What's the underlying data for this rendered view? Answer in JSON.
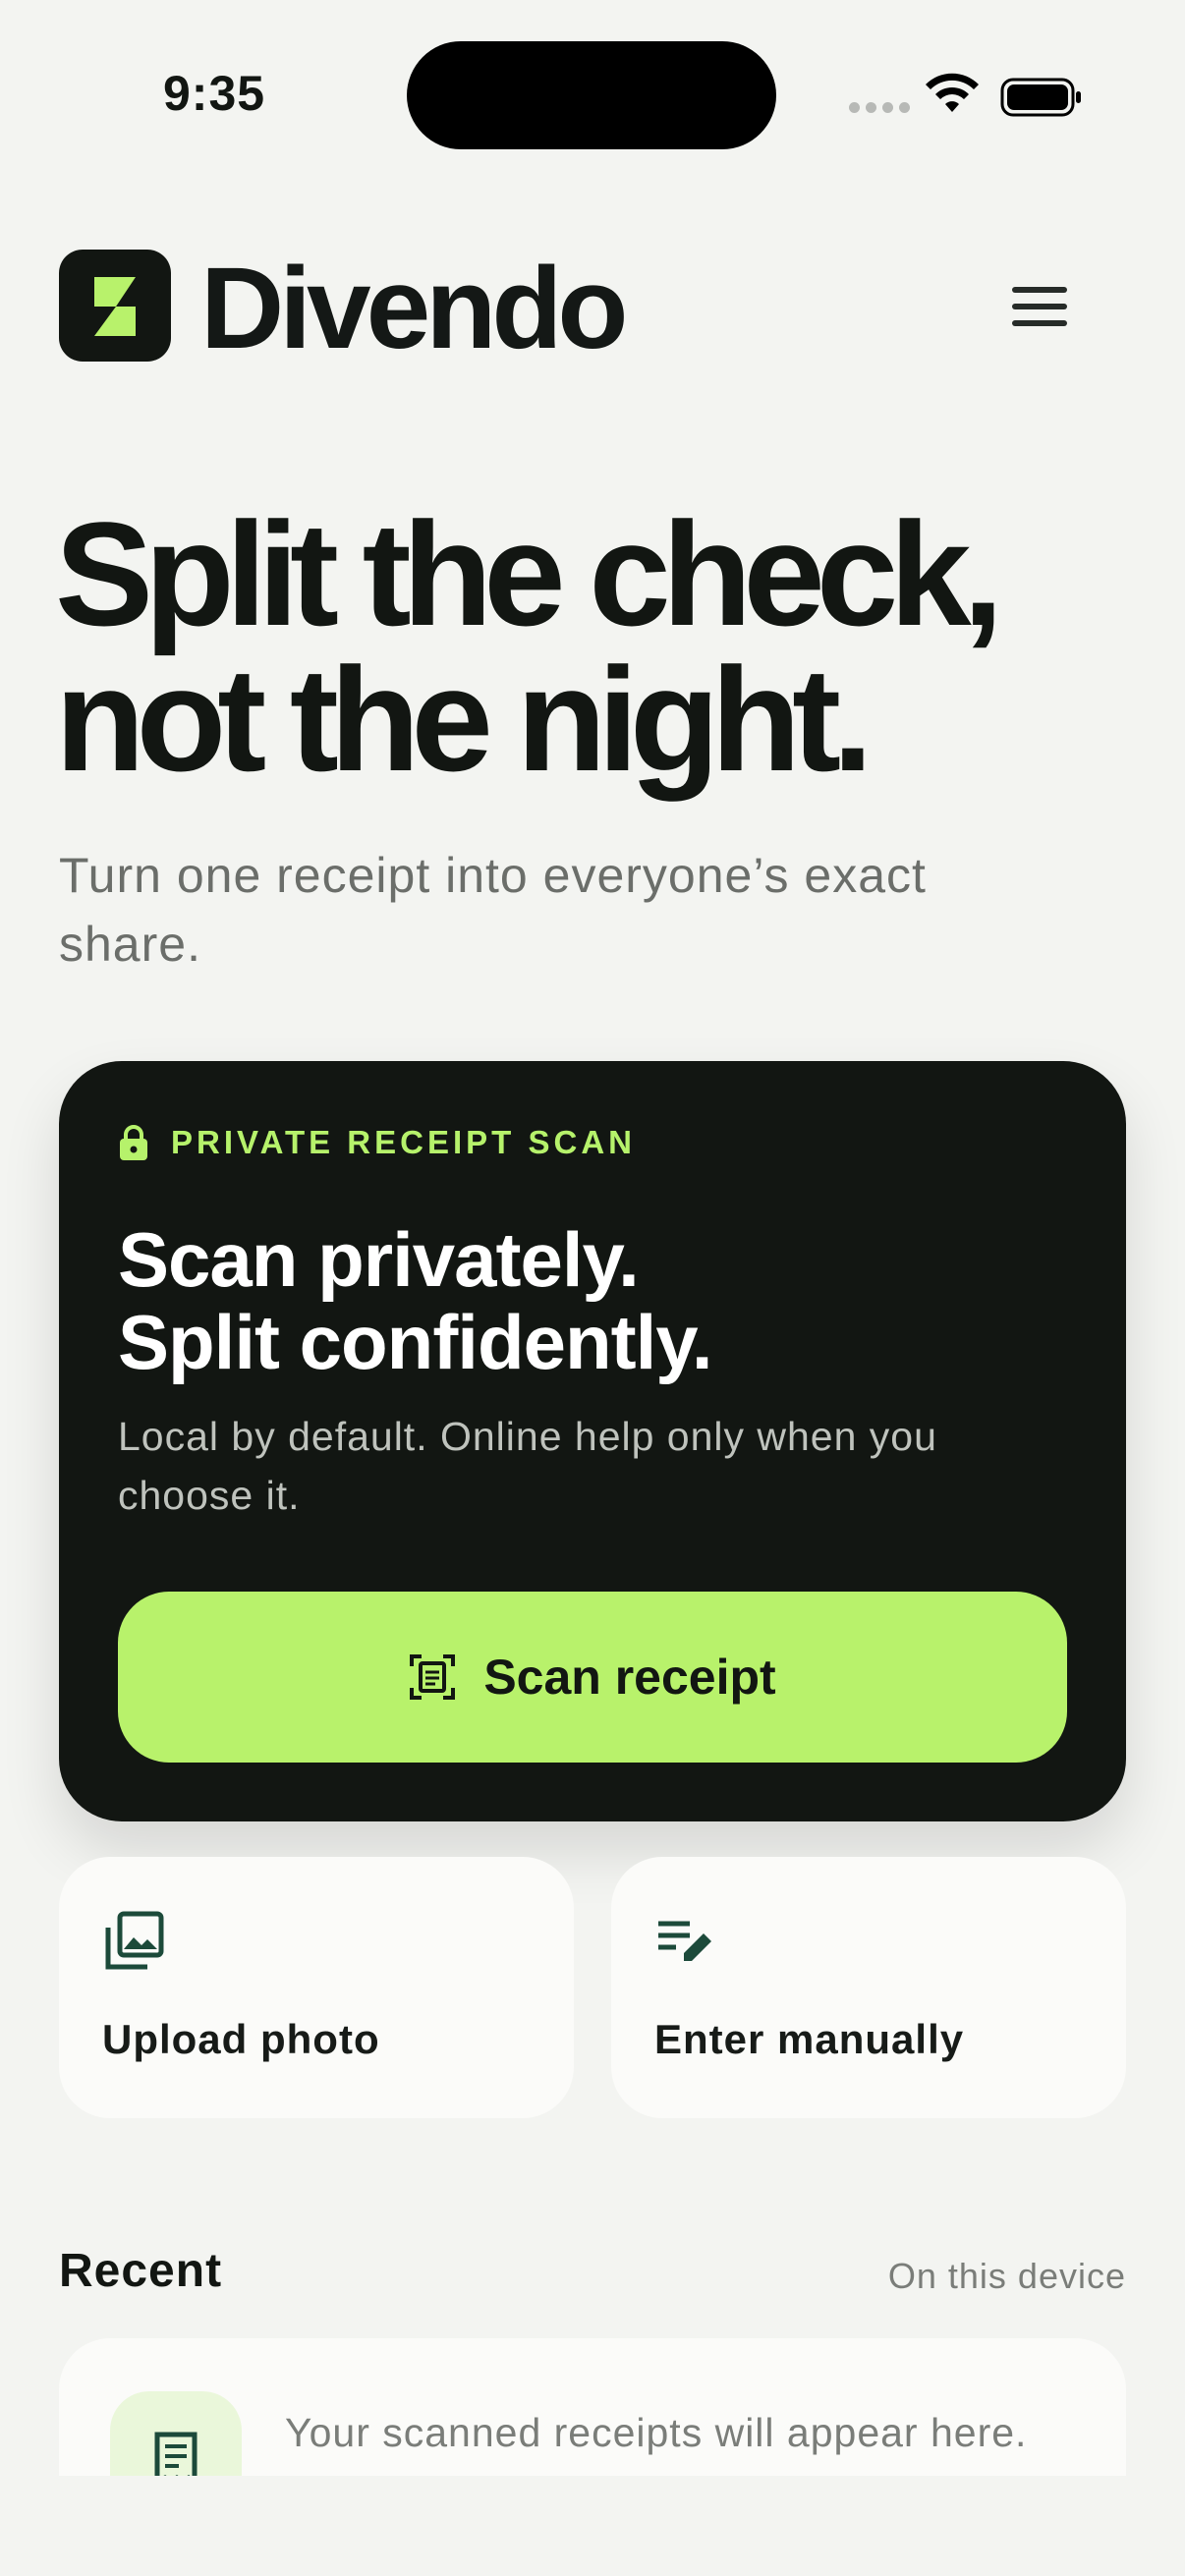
{
  "status_bar": {
    "time": "9:35"
  },
  "header": {
    "brand": "Divendo",
    "logo_icon": "divendo-logo-icon",
    "menu_icon": "hamburger-menu-icon"
  },
  "hero": {
    "title_line1": "Split the check,",
    "title_line2": "not the night.",
    "subtitle": "Turn one receipt into everyone’s exact share."
  },
  "scan_card": {
    "badge_icon": "lock-icon",
    "badge": "PRIVATE RECEIPT SCAN",
    "title_line1": "Scan privately.",
    "title_line2": "Split confidently.",
    "description": "Local by default. Online help only when you choose it.",
    "button_icon": "scan-frame-icon",
    "button_label": "Scan receipt"
  },
  "actions": {
    "upload": {
      "icon": "photo-library-icon",
      "label": "Upload photo"
    },
    "manual": {
      "icon": "edit-list-icon",
      "label": "Enter manually"
    }
  },
  "recent": {
    "title": "Recent",
    "meta": "On this device",
    "empty_icon": "receipt-icon",
    "empty_text": "Your scanned receipts will appear here."
  },
  "colors": {
    "background": "#f3f4f1",
    "dark": "#121612",
    "accent": "#b8f26b",
    "muted_text": "#6b6e6a"
  }
}
